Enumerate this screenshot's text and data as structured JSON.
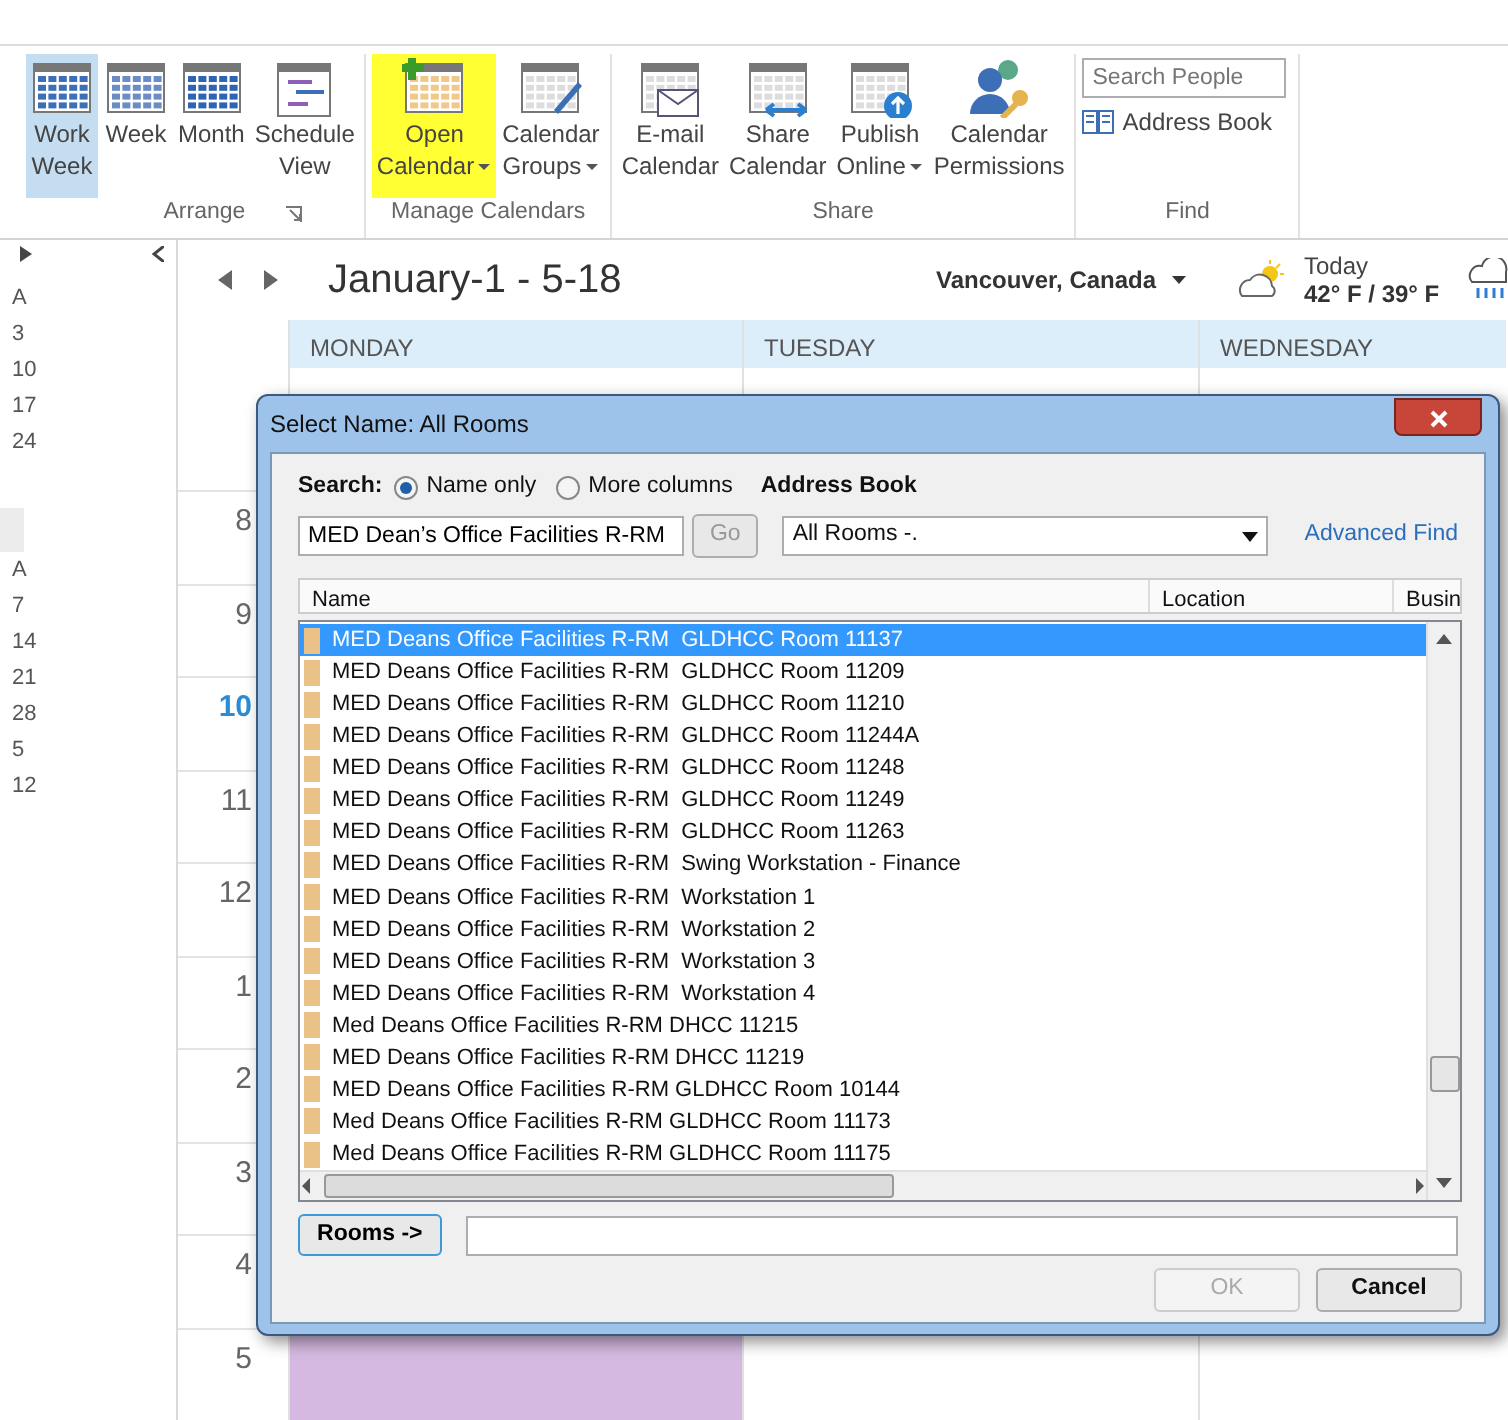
{
  "ribbon": {
    "groups": [
      {
        "label": "Arrange",
        "launcher": true,
        "buttons": [
          {
            "label": "Work Week",
            "selected": true,
            "highlighted": false,
            "dropdown": false
          },
          {
            "label": "Week",
            "selected": false,
            "highlighted": false,
            "dropdown": false
          },
          {
            "label": "Month",
            "selected": false,
            "highlighted": false,
            "dropdown": false
          },
          {
            "label": "Schedule View",
            "selected": false,
            "highlighted": false,
            "dropdown": false
          }
        ]
      },
      {
        "label": "Manage Calendars",
        "launcher": false,
        "buttons": [
          {
            "label": "Open Calendar",
            "selected": false,
            "highlighted": true,
            "dropdown": true
          },
          {
            "label": "Calendar Groups",
            "selected": false,
            "highlighted": false,
            "dropdown": true
          }
        ]
      },
      {
        "label": "Share",
        "launcher": false,
        "buttons": [
          {
            "label": "E-mail Calendar",
            "selected": false,
            "highlighted": false,
            "dropdown": false
          },
          {
            "label": "Share Calendar",
            "selected": false,
            "highlighted": false,
            "dropdown": false
          },
          {
            "label": "Publish Online",
            "selected": false,
            "highlighted": false,
            "dropdown": true
          },
          {
            "label": "Calendar Permissions",
            "selected": false,
            "highlighted": false,
            "dropdown": false
          }
        ]
      }
    ],
    "find": {
      "label": "Find",
      "search_placeholder": "Search People",
      "address_book": "Address Book"
    }
  },
  "mini_calendar": {
    "weeks_a": [
      "A",
      "3",
      "10",
      "17",
      "24"
    ],
    "weeks_b": [
      "A",
      "7",
      "14",
      "21",
      "28",
      "5",
      "12"
    ]
  },
  "calendar": {
    "title": "January-1 - 5-18",
    "location": "Vancouver, Canada",
    "weather": {
      "label": "Today",
      "temps": "42° F / 39° F"
    },
    "days": [
      "MONDAY",
      "TUESDAY",
      "WEDNESDAY"
    ],
    "hours": [
      {
        "label": "8",
        "current": false
      },
      {
        "label": "9",
        "current": false
      },
      {
        "label": "10",
        "current": true
      },
      {
        "label": "11",
        "current": false
      },
      {
        "label": "12",
        "current": false
      },
      {
        "label": "1",
        "current": false
      },
      {
        "label": "2",
        "current": false
      },
      {
        "label": "3",
        "current": false
      },
      {
        "label": "4",
        "current": false
      },
      {
        "label": "5",
        "current": false
      }
    ]
  },
  "dialog": {
    "title": "Select Name: All Rooms",
    "search_label": "Search:",
    "search_options": [
      {
        "label": "Name only",
        "selected": true
      },
      {
        "label": "More columns",
        "selected": false
      }
    ],
    "address_book_label": "Address Book",
    "search_value": "MED Dean’s Office Facilities R-RM",
    "go": {
      "label": "Go",
      "disabled": true
    },
    "address_book_value": "All Rooms -.",
    "advanced_find": "Advanced Find",
    "columns": [
      "Name",
      "Location",
      "Busin"
    ],
    "rows": [
      {
        "name": "MED Deans Office Facilities R-RM  GLDHCC Room 11137",
        "selected": true
      },
      {
        "name": "MED Deans Office Facilities R-RM  GLDHCC Room 11209",
        "selected": false
      },
      {
        "name": "MED Deans Office Facilities R-RM  GLDHCC Room 11210",
        "selected": false
      },
      {
        "name": "MED Deans Office Facilities R-RM  GLDHCC Room 11244A",
        "selected": false
      },
      {
        "name": "MED Deans Office Facilities R-RM  GLDHCC Room 11248",
        "selected": false
      },
      {
        "name": "MED Deans Office Facilities R-RM  GLDHCC Room 11249",
        "selected": false
      },
      {
        "name": "MED Deans Office Facilities R-RM  GLDHCC Room 11263",
        "selected": false
      },
      {
        "name": "MED Deans Office Facilities R-RM  Swing Workstation - Finance",
        "selected": false
      },
      {
        "name": "MED Deans Office Facilities R-RM  Workstation 1",
        "selected": false
      },
      {
        "name": "MED Deans Office Facilities R-RM  Workstation 2",
        "selected": false
      },
      {
        "name": "MED Deans Office Facilities R-RM  Workstation 3",
        "selected": false
      },
      {
        "name": "MED Deans Office Facilities R-RM  Workstation 4",
        "selected": false
      },
      {
        "name": "Med Deans Office Facilities R-RM DHCC 11215",
        "selected": false
      },
      {
        "name": "MED Deans Office Facilities R-RM DHCC 11219",
        "selected": false
      },
      {
        "name": "MED Deans Office Facilities R-RM GLDHCC Room 10144",
        "selected": false
      },
      {
        "name": "Med Deans Office Facilities R-RM GLDHCC Room 11173",
        "selected": false
      },
      {
        "name": "Med Deans Office Facilities R-RM GLDHCC Room 11175",
        "selected": false
      }
    ],
    "rooms_button": "Rooms ->",
    "ok": {
      "label": "OK",
      "disabled": true
    },
    "cancel": {
      "label": "Cancel",
      "disabled": false
    }
  }
}
